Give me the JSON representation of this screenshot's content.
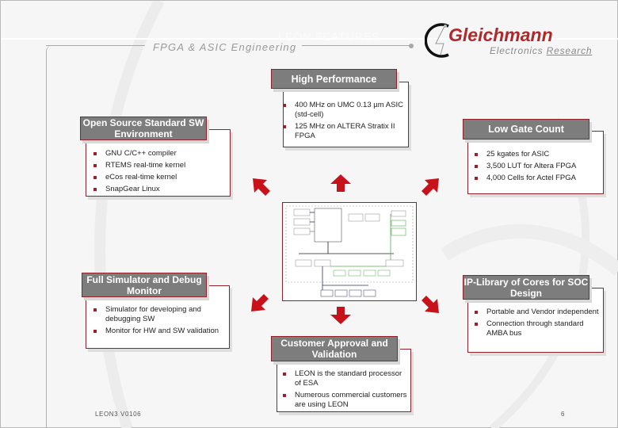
{
  "header": {
    "faint_title": "LEON FEATURES",
    "subtitle": "FPGA & ASIC Engineering"
  },
  "logo": {
    "brand": "Gleichmann",
    "sub_prefix": "Electronics ",
    "sub_highlight": "Research"
  },
  "boxes": {
    "high_performance": {
      "title": "High Performance",
      "items": [
        "400 MHz on UMC 0.13 µm ASIC (std-cell)",
        "125 MHz on ALTERA Stratix II FPGA"
      ]
    },
    "open_source": {
      "title": "Open Source Standard SW Environment",
      "items": [
        "GNU C/C++ compiler",
        "RTEMS real-time kernel",
        "eCos real-time kernel",
        "SnapGear Linux"
      ]
    },
    "low_gate": {
      "title": "Low Gate Count",
      "items": [
        "25 kgates for ASIC",
        "3,500 LUT for Altera FPGA",
        "4,000 Cells for Actel FPGA"
      ]
    },
    "simulator": {
      "title": "Full Simulator and Debug Monitor",
      "items": [
        "Simulator for developing and debugging SW",
        "Monitor for HW and SW validation"
      ]
    },
    "ip_library": {
      "title": "IP-Library of Cores for SOC Design",
      "items": [
        "Portable and Vendor independent",
        "Connection through standard AMBA bus"
      ]
    },
    "customer": {
      "title": "Customer Approval and Validation",
      "items": [
        "LEON is the standard processor of ESA",
        "Numerous commercial customers are using LEON"
      ]
    }
  },
  "footer": {
    "left": "LEON3 V0106",
    "page": "6"
  },
  "colors": {
    "accent": "#a0202a",
    "title_bar": "#7d7d7d",
    "border": "#8e2228"
  }
}
